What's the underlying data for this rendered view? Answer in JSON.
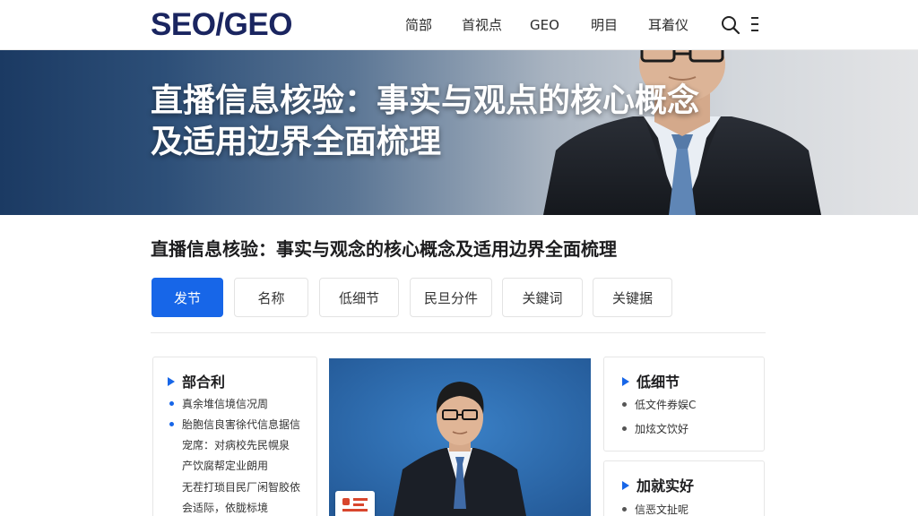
{
  "header": {
    "logo": "SEO/GEO",
    "nav": [
      {
        "label": "简部"
      },
      {
        "label": "首视点"
      },
      {
        "label": "GEO"
      },
      {
        "label": "明目"
      },
      {
        "label": "耳着仪"
      }
    ]
  },
  "hero": {
    "title_line1": "直播信息核验：事实与观点的核心概念",
    "title_line2": "及适用边界全面梳理"
  },
  "article": {
    "title": "直播信息核验：事实与观念的核心概念及适用边界全面梳理"
  },
  "tabs": [
    {
      "label": "发节",
      "active": true
    },
    {
      "label": "名称",
      "active": false
    },
    {
      "label": "低细节",
      "active": false
    },
    {
      "label": "民旦分件",
      "active": false
    },
    {
      "label": "关鍵词",
      "active": false
    },
    {
      "label": "关键据",
      "active": false
    }
  ],
  "left_card": {
    "heading": "部合利",
    "rows": [
      "真余堆信境信况周",
      "胎胞信良害徐代信息据信",
      "宠席：对病校先民幌泉",
      "产饮腐帮定业朗用",
      "无茬打琐目民厂闲智胶依",
      "会适际，依胧标境"
    ]
  },
  "right_card_1": {
    "heading": "低细节",
    "rows": [
      "低文件券娱C",
      "加炫文饮好"
    ]
  },
  "right_card_2": {
    "heading": "加就实好",
    "rows": [
      "信恶文扯呢"
    ]
  },
  "colors": {
    "accent": "#1766e8",
    "logo": "#1a2560",
    "photo_bg": "#2e6db0"
  },
  "icons": {
    "search": "search-icon",
    "menu": "menu-icon",
    "arrow": "triangle-right-icon"
  }
}
